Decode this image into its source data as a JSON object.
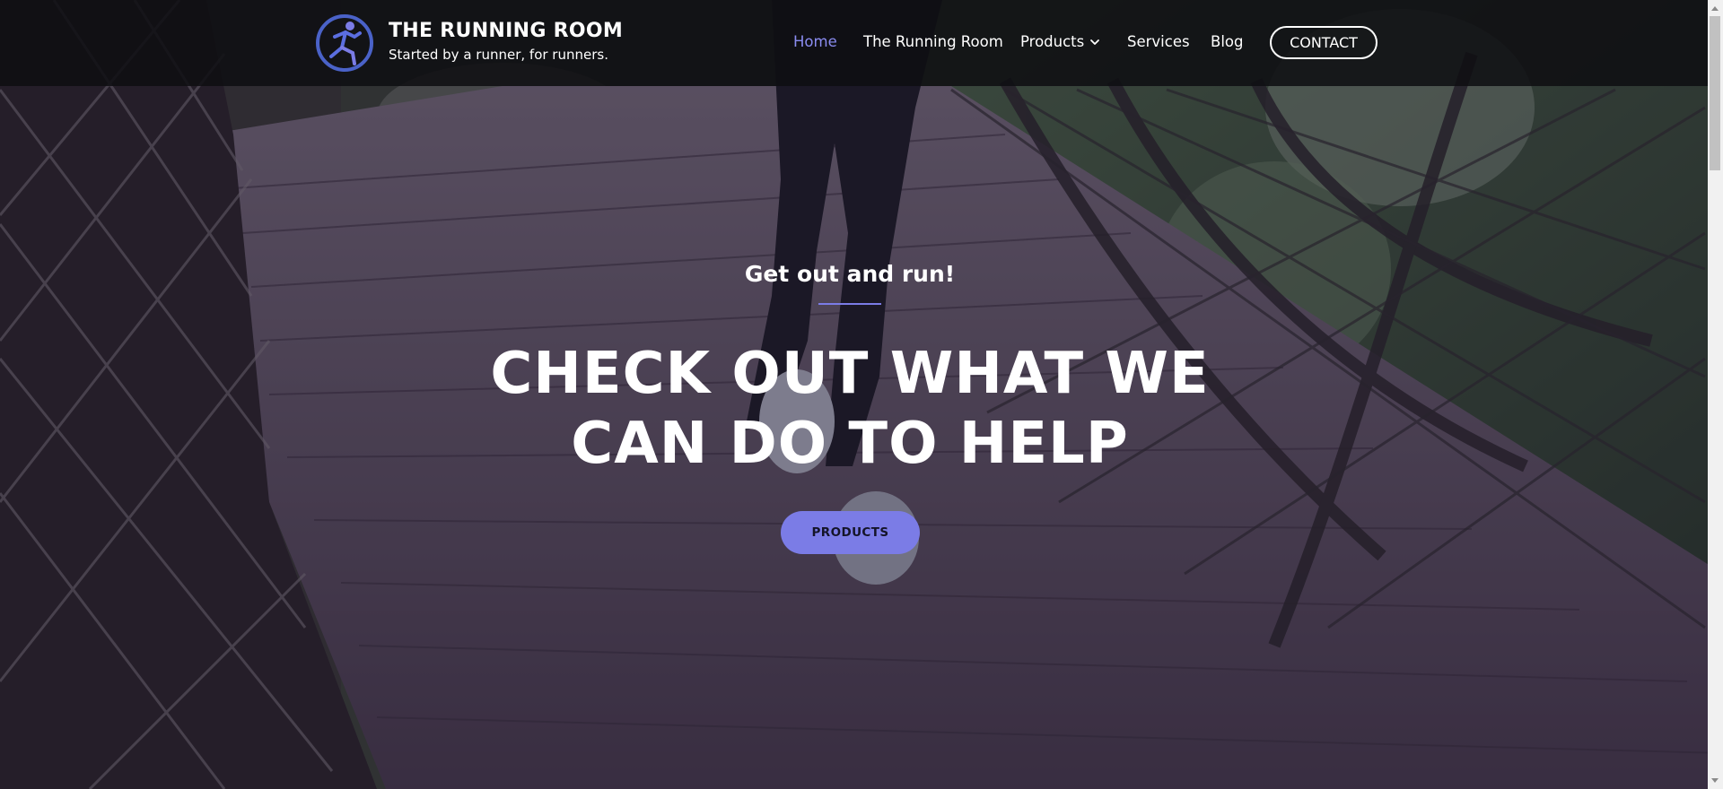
{
  "brand": {
    "title": "THE RUNNING ROOM",
    "tagline": "Started by a runner, for runners.",
    "logo_icon": "runner-logo-icon"
  },
  "nav": {
    "items": [
      {
        "label": "Home",
        "active": true
      },
      {
        "label": "The Running Room",
        "active": false
      },
      {
        "label": "Products",
        "active": false,
        "has_dropdown": true
      },
      {
        "label": "Services",
        "active": false
      },
      {
        "label": "Blog",
        "active": false
      }
    ],
    "contact_label": "CONTACT"
  },
  "hero": {
    "subheading": "Get out and run!",
    "headline_line1": "CHECK OUT WHAT WE",
    "headline_line2": "CAN DO TO HELP",
    "cta_label": "PRODUCTS"
  },
  "colors": {
    "accent": "#7b7ce6",
    "active_nav": "#8a8cf0",
    "header_bg": "#0e0e12",
    "text": "#ffffff"
  }
}
